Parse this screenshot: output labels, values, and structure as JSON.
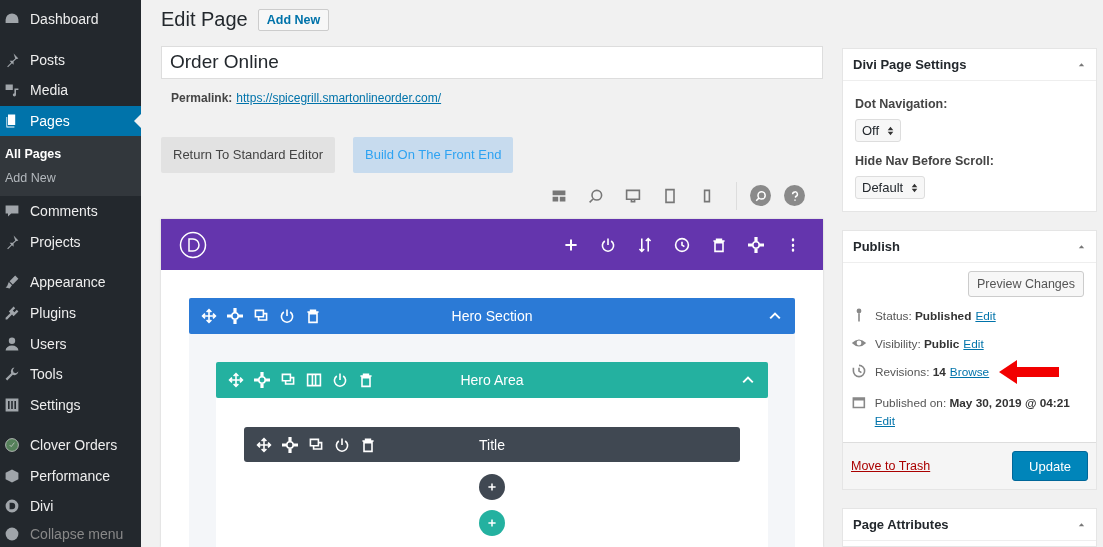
{
  "sidebar": {
    "items": [
      {
        "label": "Dashboard",
        "selected": false
      },
      {
        "label": "Posts",
        "selected": false
      },
      {
        "label": "Media",
        "selected": false
      },
      {
        "label": "Pages",
        "selected": true,
        "children": [
          {
            "label": "All Pages",
            "selected": true
          },
          {
            "label": "Add New",
            "selected": false
          }
        ]
      },
      {
        "label": "Comments",
        "selected": false
      },
      {
        "label": "Projects",
        "selected": false
      },
      {
        "label": "Appearance",
        "selected": false
      },
      {
        "label": "Plugins",
        "selected": false
      },
      {
        "label": "Users",
        "selected": false
      },
      {
        "label": "Tools",
        "selected": false
      },
      {
        "label": "Settings",
        "selected": false
      },
      {
        "label": "Clover Orders",
        "selected": false
      },
      {
        "label": "Performance",
        "selected": false
      },
      {
        "label": "Divi",
        "selected": false
      },
      {
        "label": "Collapse menu",
        "selected": false
      }
    ]
  },
  "header": {
    "title": "Edit Page",
    "add_new": "Add New"
  },
  "post_title": {
    "value": "Order Online"
  },
  "permalink": {
    "label": "Permalink:",
    "url": "https://spicegrill.smartonlineorder.com/"
  },
  "editor_buttons": [
    {
      "label": "Return To Standard Editor",
      "selected": false
    },
    {
      "label": "Build On The Front End",
      "selected": true
    }
  ],
  "builder": {
    "section": {
      "label": "Hero Section",
      "expanded": true
    },
    "row": {
      "label": "Hero Area",
      "expanded": true
    },
    "module": {
      "label": "Title"
    }
  },
  "divi_settings": {
    "title": "Divi Page Settings",
    "fields": [
      {
        "label": "Dot Navigation:",
        "value": "Off"
      },
      {
        "label": "Hide Nav Before Scroll:",
        "value": "Default"
      }
    ]
  },
  "publish": {
    "title": "Publish",
    "preview": "Preview Changes",
    "rows": [
      {
        "text": "Status: **Published**",
        "link": "Edit"
      },
      {
        "text": "Visibility: **Public**",
        "link": "Edit"
      },
      {
        "text": "Revisions: **14**",
        "link": "Browse"
      },
      {
        "text": "Published on: **May 30, 2019 @ 04:21**",
        "link": "Edit"
      }
    ],
    "trash": "Move to Trash",
    "update": "Update"
  },
  "page_attributes": {
    "title": "Page Attributes"
  }
}
